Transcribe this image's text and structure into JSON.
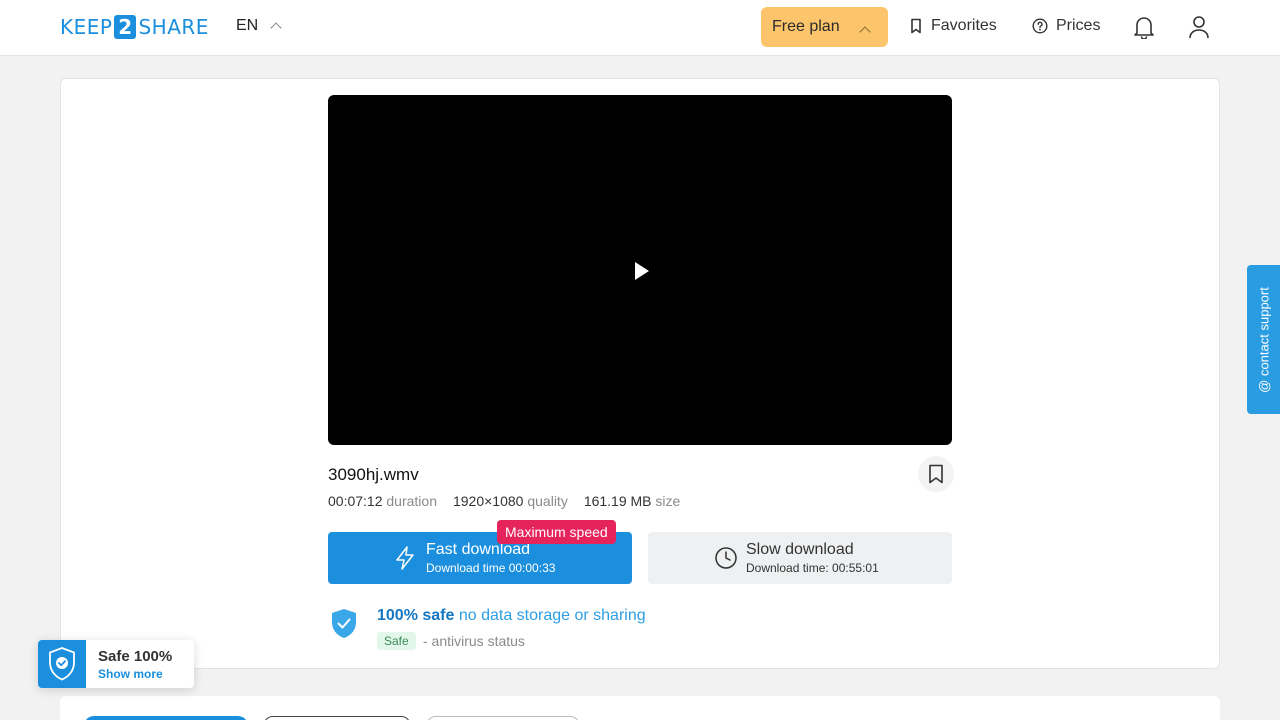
{
  "header": {
    "logo_left": "KEEP",
    "logo_mid": "2",
    "logo_right": "SHARE",
    "lang": "EN",
    "plan_label": "Free plan",
    "favorites_label": "Favorites",
    "prices_label": "Prices"
  },
  "file": {
    "name": "3090hj.wmv",
    "duration_value": "00:07:12",
    "duration_label": "duration",
    "quality_value": "1920×1080",
    "quality_label": "quality",
    "size_value": "161.19 MB",
    "size_label": "size"
  },
  "downloads": {
    "badge": "Maximum speed",
    "fast_title": "Fast download",
    "fast_sub": "Download time 00:00:33",
    "slow_title": "Slow download",
    "slow_sub": "Download time: 00:55:01"
  },
  "safety": {
    "strong": "100% safe",
    "light": "no data storage or sharing",
    "pill": "Safe",
    "status": "- antivirus status"
  },
  "support_label": "@ contact support",
  "widget": {
    "title": "Safe 100%",
    "more": "Show more"
  },
  "colors": {
    "brand": "#1b8fdd",
    "plan": "#fcc56b",
    "badge": "#e5245c"
  }
}
